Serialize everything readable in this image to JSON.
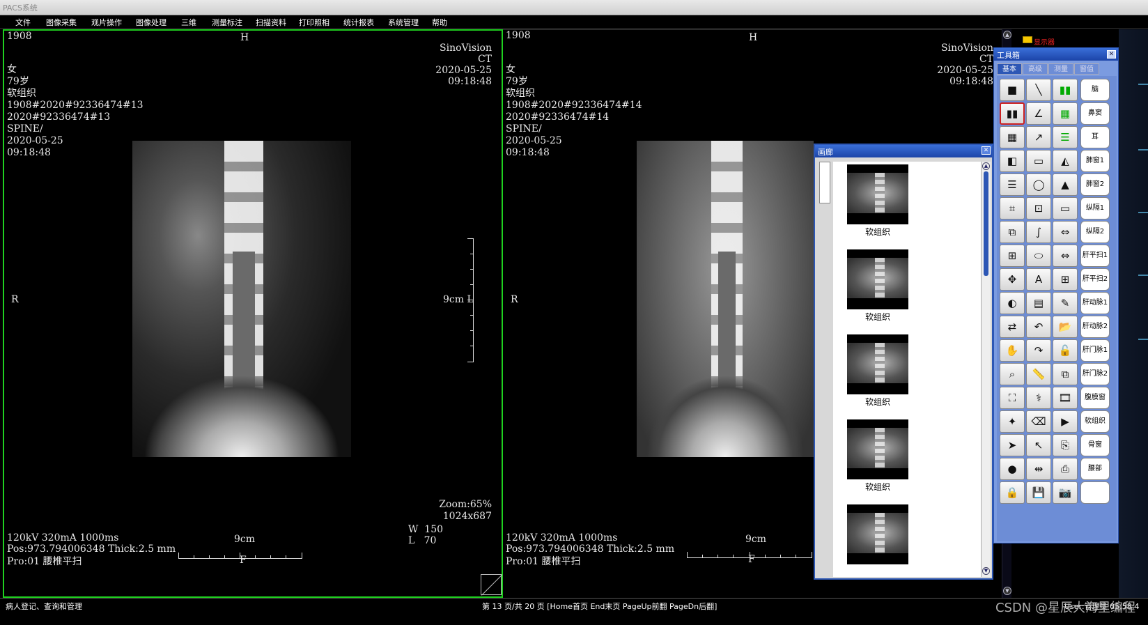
{
  "window": {
    "title": "PACS系统"
  },
  "menu": [
    "文件",
    "图像采集",
    "观片操作",
    "图像处理",
    "三维",
    "测量标注",
    "扫描资料",
    "打印照相",
    "统计报表",
    "系统管理",
    "帮助"
  ],
  "viewports": [
    {
      "id": "1908",
      "orientation_top": "H",
      "left_label": "R",
      "right_label": "9cm L",
      "bottom_scale": "9cm",
      "bottom_orient": "F",
      "patient": [
        "女",
        "79岁",
        "软组织",
        "1908#2020#92336474#13",
        "2020#92336474#13",
        "SPINE/",
        "2020-05-25",
        "09:18:48"
      ],
      "vendor": [
        "SinoVision",
        "CT",
        "2020-05-25",
        "09:18:48"
      ],
      "zoom": [
        "Zoom:65%",
        "1024x687"
      ],
      "window": [
        "W  150",
        "L   70"
      ],
      "acq": [
        "120kV 320mA 1000ms",
        "Pos:973.794006348 Thick:2.5 mm",
        "Pro:01 腰椎平扫"
      ]
    },
    {
      "id": "1908",
      "orientation_top": "H",
      "left_label": "R",
      "bottom_scale": "9cm",
      "bottom_orient": "F",
      "patient": [
        "女",
        "79岁",
        "软组织",
        "1908#2020#92336474#14",
        "2020#92336474#14",
        "SPINE/",
        "2020-05-25",
        "09:18:48"
      ],
      "vendor": [
        "SinoVision",
        "CT",
        "2020-05-25",
        "09:18:48"
      ],
      "acq": [
        "120kV 320mA 1000ms",
        "Pos:973.794006348 Thick:2.5 mm",
        "Pro:01 腰椎平扫"
      ]
    }
  ],
  "gallery": {
    "title": "画廊",
    "items": [
      "软组织",
      "软组织",
      "软组织",
      "软组织"
    ]
  },
  "toolbox": {
    "title": "工具箱",
    "tabs": [
      "基本",
      "高级",
      "测量",
      "窗值"
    ],
    "presets": [
      "脑",
      "鼻窦",
      "耳",
      "肺窗1",
      "肺窗2",
      "纵隔1",
      "纵隔2",
      "肝平扫1",
      "肝平扫2",
      "肝动脉1",
      "肝动脉2",
      "肝门脉1",
      "肝门脉2",
      "腹膜窗",
      "软组织",
      "骨窗",
      "腰部",
      ""
    ]
  },
  "side": {
    "folder_label": "显示器"
  },
  "status": {
    "left": "病人登记、查询和管理",
    "center": "第 13 页/共 20 页 [Home首页 End末页 PageUp前翻 PageDn后翻]",
    "right": "User:管理员  05:58:4"
  },
  "watermark": "CSDN @星辰大海里编程"
}
